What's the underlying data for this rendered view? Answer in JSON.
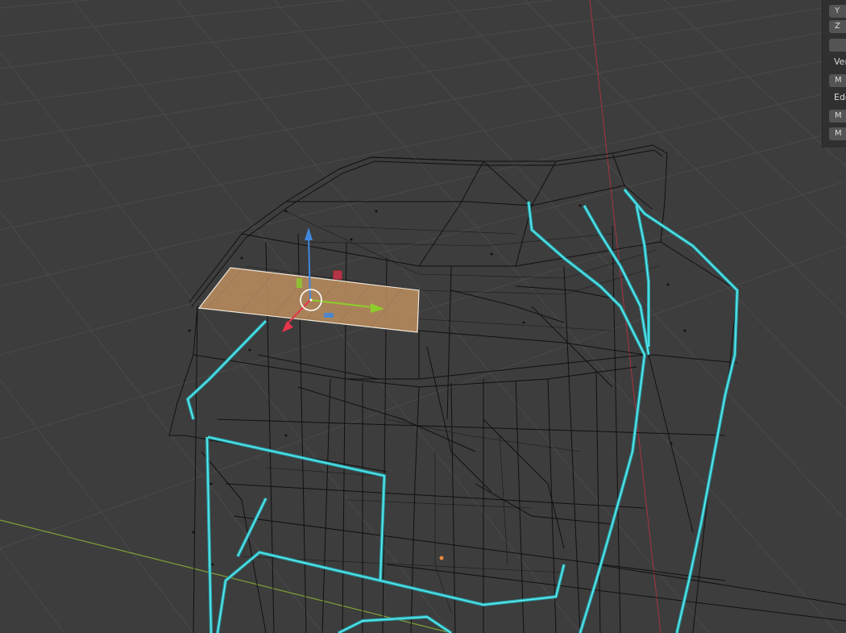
{
  "viewport": {
    "name": "3D Viewport",
    "mode": "Edit Mode - Wireframe",
    "colors": {
      "background": "#3d3d3d",
      "grid": "#4b4b4b",
      "wire": "#0c0c0c",
      "seam": "#40d8e0",
      "selected_face": "#b98c5e",
      "x_axis": "#b33a47",
      "y_axis": "#7ea236",
      "gizmo_x": "#e8344c",
      "gizmo_y": "#8ccd2a",
      "gizmo_z": "#3f88e0",
      "origin": "#e8893c"
    }
  },
  "npanel": {
    "y_label": "Y",
    "z_label": "Z",
    "vertex_label": "Ver",
    "edge_label": "Edg",
    "vertex_button": "M",
    "edge_button_1": "M",
    "edge_button_2": "M"
  }
}
